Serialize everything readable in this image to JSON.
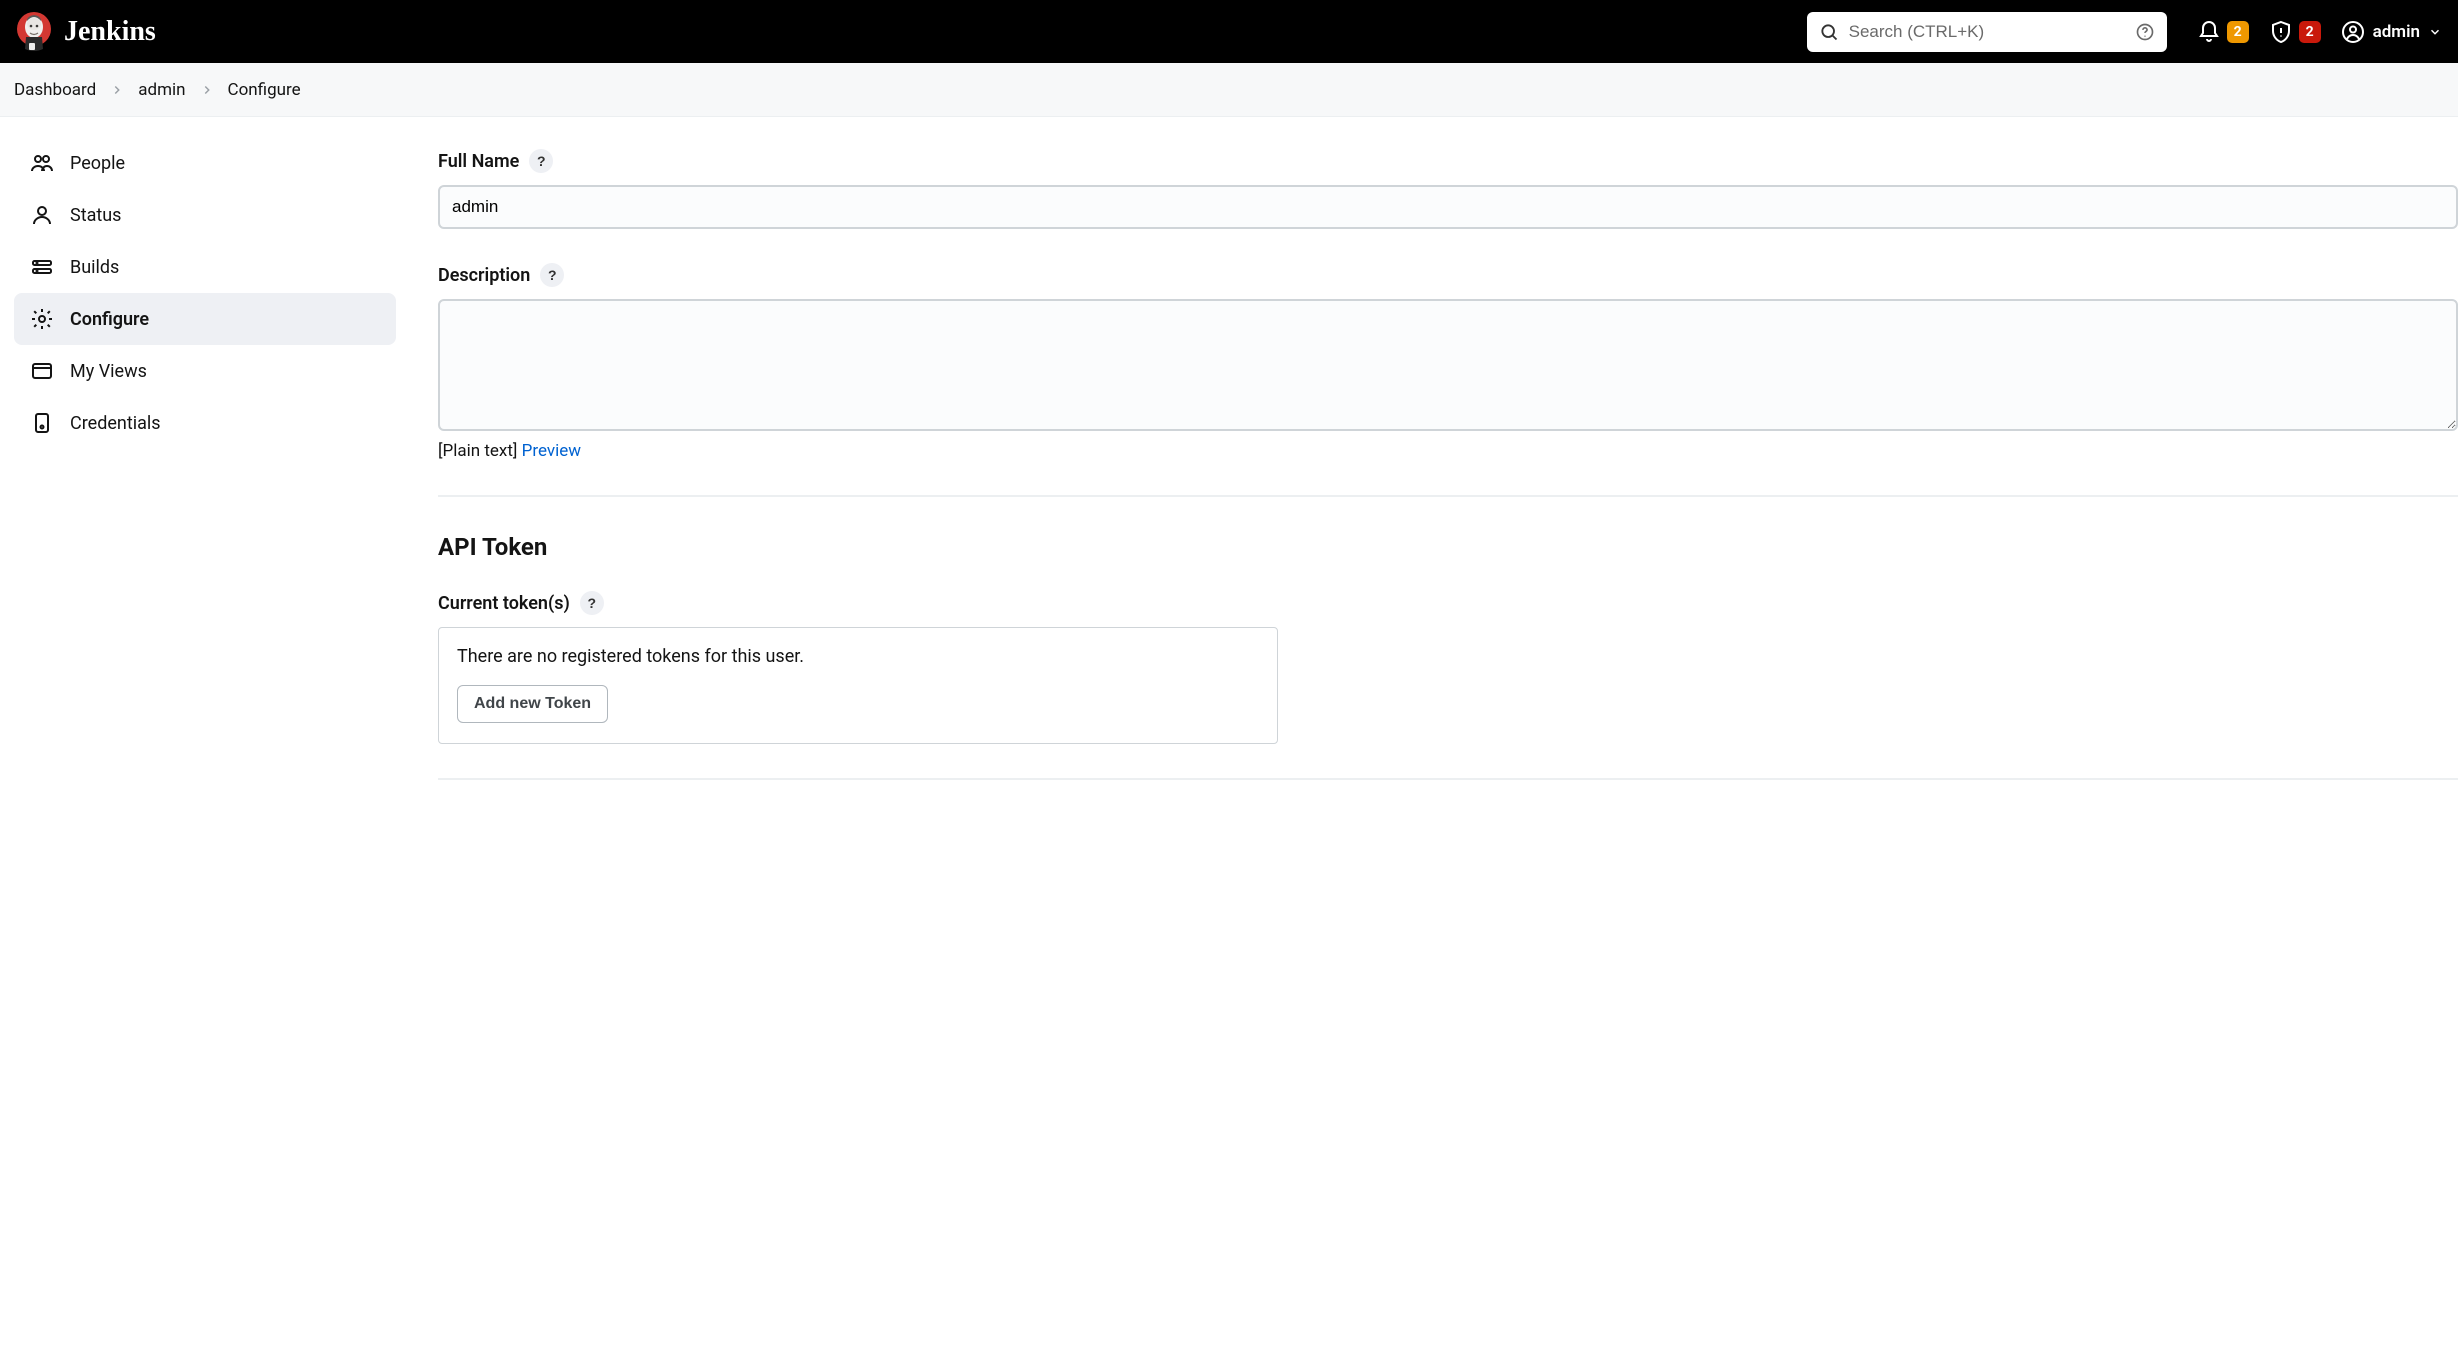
{
  "header": {
    "app_name": "Jenkins",
    "search_placeholder": "Search (CTRL+K)",
    "notification_count": "2",
    "security_count": "2",
    "user_label": "admin"
  },
  "breadcrumb": {
    "items": [
      "Dashboard",
      "admin",
      "Configure"
    ]
  },
  "sidebar": {
    "items": [
      {
        "label": "People"
      },
      {
        "label": "Status"
      },
      {
        "label": "Builds"
      },
      {
        "label": "Configure"
      },
      {
        "label": "My Views"
      },
      {
        "label": "Credentials"
      }
    ]
  },
  "form": {
    "full_name_label": "Full Name",
    "full_name_value": "admin",
    "description_label": "Description",
    "description_value": "",
    "plain_text_label": "[Plain text]",
    "preview_label": "Preview"
  },
  "api_token": {
    "heading": "API Token",
    "current_label": "Current token(s)",
    "empty_message": "There are no registered tokens for this user.",
    "add_button": "Add new Token"
  },
  "help_glyph": "?"
}
